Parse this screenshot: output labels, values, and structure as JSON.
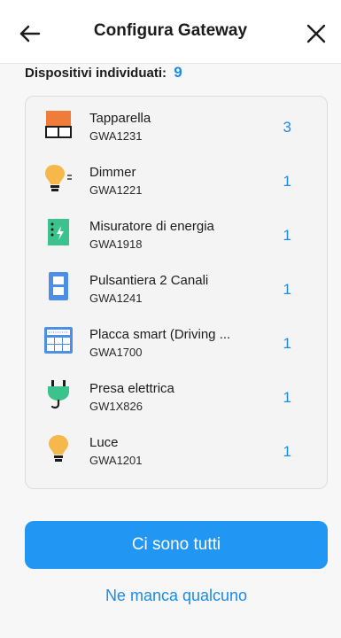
{
  "header": {
    "title": "Configura Gateway"
  },
  "summary": {
    "label": "Dispositivi individuati:",
    "count": "9"
  },
  "devices": [
    {
      "name": "Tapparella",
      "code": "GWA1231",
      "qty": "3",
      "icon": "shutter-icon"
    },
    {
      "name": "Dimmer",
      "code": "GWA1221",
      "qty": "1",
      "icon": "dimmer-bulb-icon"
    },
    {
      "name": "Misuratore di energia",
      "code": "GWA1918",
      "qty": "1",
      "icon": "energy-meter-icon"
    },
    {
      "name": "Pulsantiera 2 Canali",
      "code": "GWA1241",
      "qty": "1",
      "icon": "keypad-icon"
    },
    {
      "name": "Placca smart (Driving ...",
      "code": "GWA1700",
      "qty": "1",
      "icon": "smart-plate-icon"
    },
    {
      "name": "Presa elettrica",
      "code": "GW1X826",
      "qty": "1",
      "icon": "plug-icon"
    },
    {
      "name": "Luce",
      "code": "GWA1201",
      "qty": "1",
      "icon": "bulb-icon"
    }
  ],
  "actions": {
    "confirm": "Ci sono tutti",
    "missing": "Ne manca qualcuno"
  },
  "colors": {
    "accent": "#2196f3",
    "count": "#1b8be8"
  }
}
